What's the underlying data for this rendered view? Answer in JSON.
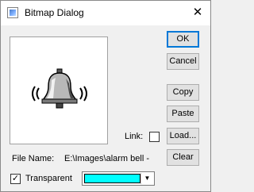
{
  "window": {
    "title": "Bitmap Dialog",
    "close_glyph": "✕",
    "app_icon": "bitmap-dialog-icon"
  },
  "preview": {
    "image_icon": "alarm-bell-icon"
  },
  "buttons": {
    "ok": "OK",
    "cancel": "Cancel",
    "copy": "Copy",
    "paste": "Paste",
    "load": "Load...",
    "clear": "Clear"
  },
  "link": {
    "label": "Link:",
    "checked": false
  },
  "file": {
    "label": "File Name:",
    "value": "E:\\Images\\alarm bell -"
  },
  "transparent": {
    "label": "Transparent",
    "checked": true,
    "check_glyph": "✓",
    "color": "#00ffff",
    "arrow_glyph": "▼"
  }
}
